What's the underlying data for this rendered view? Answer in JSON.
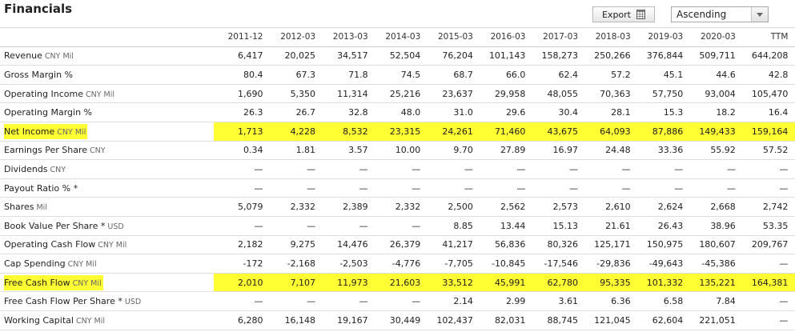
{
  "header": {
    "title": "Financials",
    "export_label": "Export",
    "sort_value": "Ascending"
  },
  "columns": [
    "2011-12",
    "2012-03",
    "2013-03",
    "2014-03",
    "2015-03",
    "2016-03",
    "2017-03",
    "2018-03",
    "2019-03",
    "2020-03",
    "TTM"
  ],
  "rows": [
    {
      "label": "Revenue",
      "unit": "CNY Mil",
      "highlight": false,
      "values": [
        "6,417",
        "20,025",
        "34,517",
        "52,504",
        "76,204",
        "101,143",
        "158,273",
        "250,266",
        "376,844",
        "509,711",
        "644,208"
      ]
    },
    {
      "label": "Gross Margin %",
      "unit": "",
      "highlight": false,
      "values": [
        "80.4",
        "67.3",
        "71.8",
        "74.5",
        "68.7",
        "66.0",
        "62.4",
        "57.2",
        "45.1",
        "44.6",
        "42.8"
      ]
    },
    {
      "label": "Operating Income",
      "unit": "CNY Mil",
      "highlight": false,
      "values": [
        "1,690",
        "5,350",
        "11,314",
        "25,216",
        "23,637",
        "29,958",
        "48,055",
        "70,363",
        "57,750",
        "93,004",
        "105,470"
      ]
    },
    {
      "label": "Operating Margin %",
      "unit": "",
      "highlight": false,
      "values": [
        "26.3",
        "26.7",
        "32.8",
        "48.0",
        "31.0",
        "29.6",
        "30.4",
        "28.1",
        "15.3",
        "18.2",
        "16.4"
      ]
    },
    {
      "label": "Net Income",
      "unit": "CNY Mil",
      "highlight": true,
      "values": [
        "1,713",
        "4,228",
        "8,532",
        "23,315",
        "24,261",
        "71,460",
        "43,675",
        "64,093",
        "87,886",
        "149,433",
        "159,164"
      ]
    },
    {
      "label": "Earnings Per Share",
      "unit": "CNY",
      "highlight": false,
      "values": [
        "0.34",
        "1.81",
        "3.57",
        "10.00",
        "9.70",
        "27.89",
        "16.97",
        "24.48",
        "33.36",
        "55.92",
        "57.52"
      ]
    },
    {
      "label": "Dividends",
      "unit": "CNY",
      "highlight": false,
      "values": [
        "—",
        "—",
        "—",
        "—",
        "—",
        "—",
        "—",
        "—",
        "—",
        "—",
        "—"
      ]
    },
    {
      "label": "Payout Ratio % *",
      "unit": "",
      "highlight": false,
      "values": [
        "—",
        "—",
        "—",
        "—",
        "—",
        "—",
        "—",
        "—",
        "—",
        "—",
        "—"
      ]
    },
    {
      "label": "Shares",
      "unit": "Mil",
      "highlight": false,
      "values": [
        "5,079",
        "2,332",
        "2,389",
        "2,332",
        "2,500",
        "2,562",
        "2,573",
        "2,610",
        "2,624",
        "2,668",
        "2,742"
      ]
    },
    {
      "label": "Book Value Per Share *",
      "unit": "USD",
      "highlight": false,
      "values": [
        "—",
        "—",
        "—",
        "—",
        "8.85",
        "13.44",
        "15.13",
        "21.61",
        "26.43",
        "38.96",
        "53.35"
      ]
    },
    {
      "label": "Operating Cash Flow",
      "unit": "CNY Mil",
      "highlight": false,
      "values": [
        "2,182",
        "9,275",
        "14,476",
        "26,379",
        "41,217",
        "56,836",
        "80,326",
        "125,171",
        "150,975",
        "180,607",
        "209,767"
      ]
    },
    {
      "label": "Cap Spending",
      "unit": "CNY Mil",
      "highlight": false,
      "values": [
        "-172",
        "-2,168",
        "-2,503",
        "-4,776",
        "-7,705",
        "-10,845",
        "-17,546",
        "-29,836",
        "-49,643",
        "-45,386",
        "—"
      ]
    },
    {
      "label": "Free Cash Flow",
      "unit": "CNY Mil",
      "highlight": true,
      "values": [
        "2,010",
        "7,107",
        "11,973",
        "21,603",
        "33,512",
        "45,991",
        "62,780",
        "95,335",
        "101,332",
        "135,221",
        "164,381"
      ]
    },
    {
      "label": "Free Cash Flow Per Share *",
      "unit": "USD",
      "highlight": false,
      "values": [
        "—",
        "—",
        "—",
        "—",
        "2.14",
        "2.99",
        "3.61",
        "6.36",
        "6.58",
        "7.84",
        "—"
      ]
    },
    {
      "label": "Working Capital",
      "unit": "CNY Mil",
      "highlight": false,
      "values": [
        "6,280",
        "16,148",
        "19,167",
        "30,449",
        "102,437",
        "82,031",
        "88,745",
        "121,045",
        "62,604",
        "221,051",
        "—"
      ]
    }
  ],
  "colors": {
    "highlight": "#ffff33",
    "unit_text": "#666666",
    "grid_line": "#dedede"
  }
}
